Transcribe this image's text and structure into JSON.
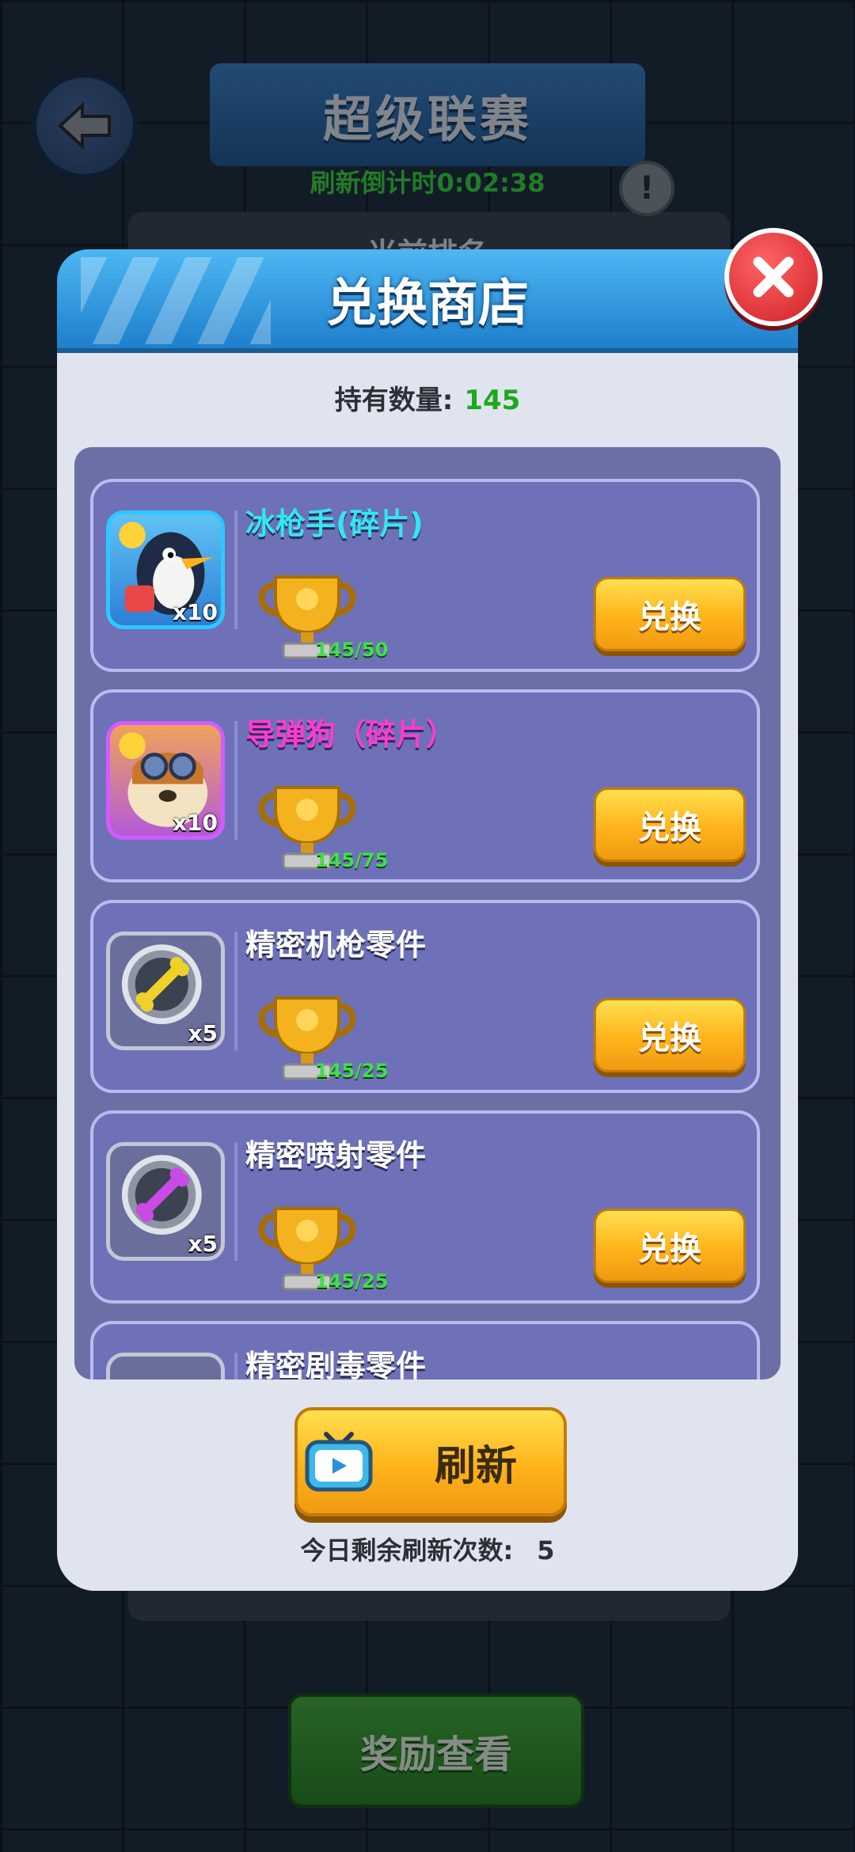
{
  "background_screen": {
    "title": "超级联赛",
    "countdown": "刷新倒计时0:02:38",
    "ranking_header": "当前排名",
    "reward_button": "奖励查看",
    "info_icon": "exclamation-icon"
  },
  "modal": {
    "title": "兑换商店",
    "held_label": "持有数量:",
    "held_value": "145",
    "items": [
      {
        "name": "冰枪手(碎片)",
        "name_color": "#35e6f2",
        "qty": "x10",
        "cost": "145/50",
        "button": "兑换",
        "icon": "penguin-hero-icon"
      },
      {
        "name": "导弹狗（碎片）",
        "name_color": "#ff3cd2",
        "qty": "x10",
        "cost": "145/75",
        "button": "兑换",
        "icon": "goggle-dog-hero-icon"
      },
      {
        "name": "精密机枪零件",
        "name_color": "#ffffff",
        "qty": "x5",
        "cost": "145/25",
        "button": "兑换",
        "icon": "yellow-bone-part-icon"
      },
      {
        "name": "精密喷射零件",
        "name_color": "#ffffff",
        "qty": "x5",
        "cost": "145/25",
        "button": "兑换",
        "icon": "purple-bone-part-icon"
      },
      {
        "name": "精密剧毒零件",
        "name_color": "#ffffff",
        "qty": "",
        "cost": "",
        "button": "",
        "icon": "part-icon"
      }
    ],
    "refresh_button": "刷新",
    "remaining_label": "今日剩余刷新次数:",
    "remaining_value": "5"
  },
  "colors": {
    "header_blue": "#1e7fcc",
    "exchange_yellow": "#ffb31a",
    "cost_green": "#3fe04a",
    "close_red": "#cf1f25"
  }
}
